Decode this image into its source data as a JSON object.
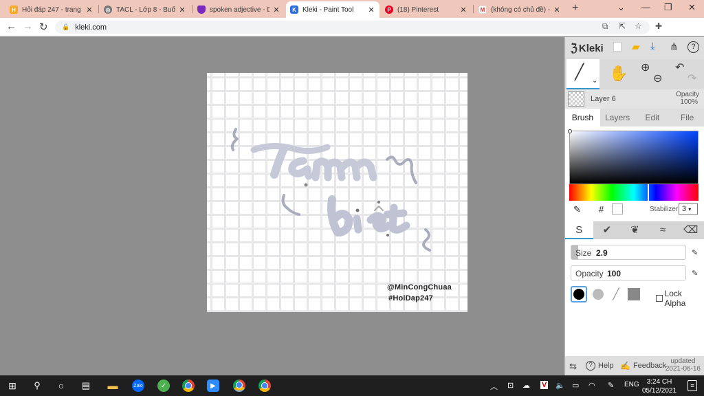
{
  "browser": {
    "tabs": [
      {
        "title": "Hỏi đáp 247 - trang tr",
        "icon": "hoidap247-favicon",
        "color": "#f5a623",
        "active": false
      },
      {
        "title": "TACL - Lớp 8 - Buổi 2",
        "icon": "globe-icon",
        "color": "#555555",
        "active": false
      },
      {
        "title": "spoken adjective - De",
        "icon": "shield-favicon",
        "color": "#7b2cbf",
        "active": false
      },
      {
        "title": "Kleki - Paint Tool",
        "icon": "kleki-favicon",
        "color": "#2b6de0",
        "active": true
      },
      {
        "title": "(18) Pinterest",
        "icon": "pinterest-favicon",
        "color": "#e60023",
        "active": false
      },
      {
        "title": "(không có chủ đề) - h",
        "icon": "gmail-favicon",
        "color": "#d93025",
        "active": false
      }
    ],
    "new_tab": "+",
    "url": "kleki.com"
  },
  "canvas": {
    "signature_line1": "@MinCongChuaa",
    "signature_line2": "#HoiDap247"
  },
  "panel": {
    "app_name": "Kleki",
    "layer_name": "Layer 6",
    "opacity_label": "Opacity",
    "opacity_value": "100%",
    "tabs": [
      "Brush",
      "Layers",
      "Edit",
      "File"
    ],
    "hash": "#",
    "stabilizer_label": "Stabilizer",
    "stabilizer_value": "3",
    "size_label": "Size",
    "size_value": "2.9",
    "size_fraction": 0.06,
    "opacity_slider_label": "Opacity",
    "opacity_slider_value": "100",
    "lock_alpha": "Lock Alpha",
    "help": "Help",
    "feedback": "Feedback",
    "updated_label": "updated",
    "updated_date": "2021-06-16"
  },
  "taskbar": {
    "lang": "ENG",
    "time": "3:24 CH",
    "date": "05/12/2021"
  }
}
